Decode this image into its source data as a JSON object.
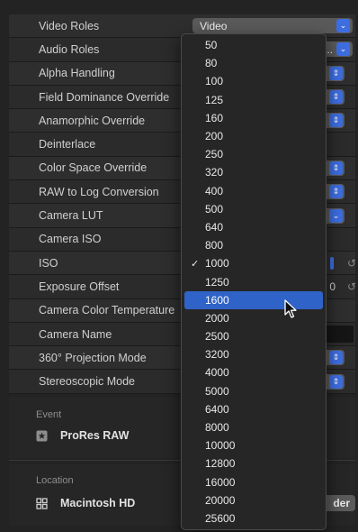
{
  "inspector": {
    "rows": [
      {
        "label": "Video Roles",
        "control": "popup-wide",
        "value": "Video"
      },
      {
        "label": "Audio Roles",
        "control": "popup-wide",
        "value": "..."
      },
      {
        "label": "Alpha Handling",
        "control": "mini-popup"
      },
      {
        "label": "Field Dominance Override",
        "control": "mini-popup"
      },
      {
        "label": "Anamorphic Override",
        "control": "mini-popup"
      },
      {
        "label": "Deinterlace",
        "control": "none"
      },
      {
        "label": "Color Space Override",
        "control": "mini-popup"
      },
      {
        "label": "RAW to Log Conversion",
        "control": "mini-popup"
      },
      {
        "label": "Camera LUT",
        "control": "mini-popup"
      },
      {
        "label": "Camera ISO",
        "control": "none"
      },
      {
        "label": "ISO",
        "control": "iso"
      },
      {
        "label": "Exposure Offset",
        "control": "exposure",
        "value": "0",
        "revert": "↺"
      },
      {
        "label": "Camera Color Temperature",
        "control": "none"
      },
      {
        "label": "Camera Name",
        "control": "text-well"
      },
      {
        "label": "360° Projection Mode",
        "control": "mini-popup"
      },
      {
        "label": "Stereoscopic Mode",
        "control": "mini-popup"
      }
    ],
    "event": {
      "title": "Event",
      "value": "ProRes RAW",
      "icon": "star-icon"
    },
    "location": {
      "title": "Location",
      "value": "Macintosh HD",
      "icon": "grid-icon",
      "button": "der"
    }
  },
  "iso_menu": {
    "selected": "1000",
    "highlighted": "1600",
    "options": [
      "50",
      "80",
      "100",
      "125",
      "160",
      "200",
      "250",
      "320",
      "400",
      "500",
      "640",
      "800",
      "1000",
      "1250",
      "1600",
      "2000",
      "2500",
      "3200",
      "4000",
      "5000",
      "6400",
      "8000",
      "10000",
      "12800",
      "16000",
      "20000",
      "25600"
    ]
  },
  "colors": {
    "accent": "#3d6de0",
    "highlight": "#2f63c7"
  }
}
